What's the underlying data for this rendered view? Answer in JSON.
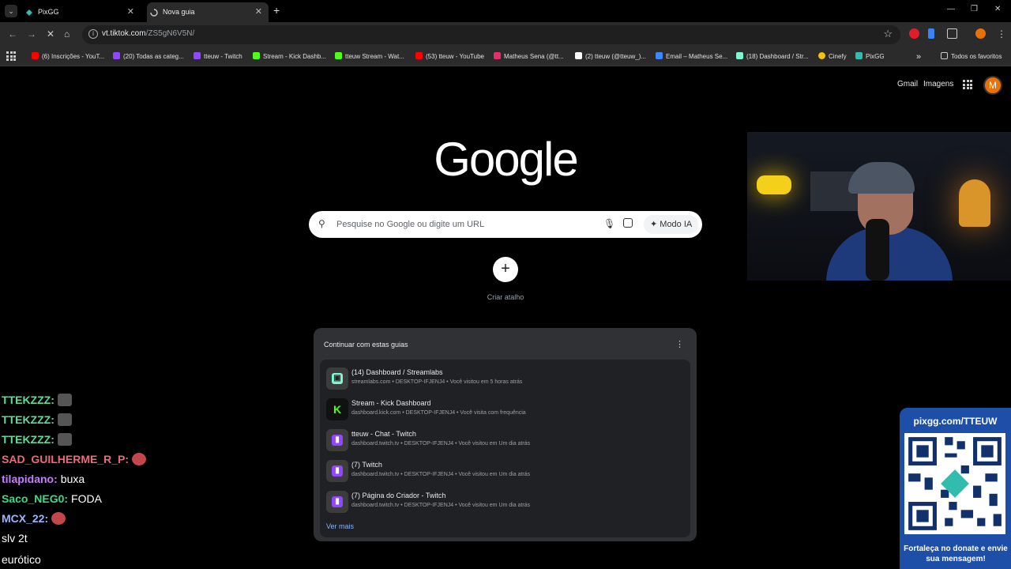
{
  "tabs": [
    {
      "title": "PixGG",
      "active": false
    },
    {
      "title": "Nova guia",
      "active": true
    }
  ],
  "address_bar": {
    "host": "vt.tiktok.com",
    "path": "/ZS5gN6V5N/"
  },
  "bookmarks": [
    {
      "label": "(6) Inscrições - YouT...",
      "color": "#ff0000"
    },
    {
      "label": "(20) Todas as categ...",
      "color": "#9146ff"
    },
    {
      "label": "tteuw - Twitch",
      "color": "#9146ff"
    },
    {
      "label": "Stream - Kick Dashb...",
      "color": "#53fc18"
    },
    {
      "label": "tteuw Stream - Wat...",
      "color": "#53fc18"
    },
    {
      "label": "(53) tteuw - YouTube",
      "color": "#ff0000"
    },
    {
      "label": "Matheus Sena (@tt...",
      "color": "#e1306c"
    },
    {
      "label": "(2) tteuw (@tteuw_)...",
      "color": "#ffffff"
    },
    {
      "label": "Email – Matheus Se...",
      "color": "#4285f4"
    },
    {
      "label": "(18) Dashboard / Str...",
      "color": "#80f5d2"
    },
    {
      "label": "Cinefy",
      "color": "#f4c20d"
    },
    {
      "label": "PixGG",
      "color": "#32bcad"
    }
  ],
  "bookmarks_overflow": "»",
  "all_bookmarks": "Todos os favoritos",
  "google": {
    "links": {
      "gmail": "Gmail",
      "images": "Imagens"
    },
    "avatar_letter": "M",
    "logo": "Google",
    "search_placeholder": "Pesquise no Google ou digite um URL",
    "ai_mode": "Modo IA",
    "shortcut_label": "Criar atalho"
  },
  "continue_panel": {
    "heading": "Continuar com estas guias",
    "items": [
      {
        "title": "(14) Dashboard / Streamlabs",
        "subtitle": "streamlabs.com • DESKTOP-IFJENJ4 • Você visitou em 5 horas atrás",
        "color": "#80f5d2"
      },
      {
        "title": "Stream - Kick Dashboard",
        "subtitle": "dashboard.kick.com • DESKTOP-IFJENJ4 • Você visita com frequência",
        "color": "#53fc18"
      },
      {
        "title": "tteuw - Chat - Twitch",
        "subtitle": "dashboard.twitch.tv • DESKTOP-IFJENJ4 • Você visitou em Um dia atrás",
        "color": "#9146ff"
      },
      {
        "title": "(7) Twitch",
        "subtitle": "dashboard.twitch.tv • DESKTOP-IFJENJ4 • Você visitou em Um dia atrás",
        "color": "#9146ff"
      },
      {
        "title": "(7) Página do Criador - Twitch",
        "subtitle": "dashboard.twitch.tv • DESKTOP-IFJENJ4 • Você visitou em Um dia atrás",
        "color": "#9146ff"
      }
    ],
    "more": "Ver mais"
  },
  "chat": [
    {
      "user": "TTEKZZZ:",
      "color": "#5ddc9a",
      "text": "",
      "emote": "grey"
    },
    {
      "user": "TTEKZZZ:",
      "color": "#5ddc9a",
      "text": "",
      "emote": "grey"
    },
    {
      "user": "TTEKZZZ:",
      "color": "#5ddc9a",
      "text": "",
      "emote": "grey"
    },
    {
      "user": "SAD_GUILHERME_R_P:",
      "color": "#f0697a",
      "text": "",
      "emote": "red"
    },
    {
      "user": "tilapidano:",
      "color": "#c77dff",
      "text": "buxa",
      "emote": ""
    },
    {
      "user": "Saco_NEG0:",
      "color": "#3ddc84",
      "text": "FODA",
      "emote": ""
    },
    {
      "user": "MCX_22:",
      "color": "#9db4ff",
      "text": "",
      "emote": "red"
    },
    {
      "user": "",
      "color": "#ffffff",
      "text": "slv 2t",
      "emote": ""
    },
    {
      "user": "",
      "color": "#ffffff",
      "text": "eurótico",
      "emote": ""
    }
  ],
  "donate": {
    "url": "pixgg.com/TTEUW",
    "footer": "Fortaleça no donate e envie sua mensagem!"
  }
}
